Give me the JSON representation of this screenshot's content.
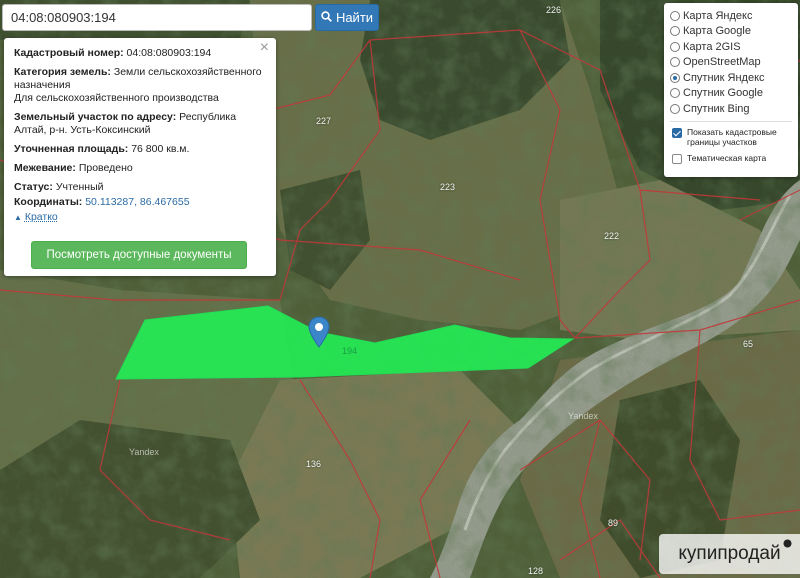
{
  "search": {
    "value": "04:08:080903:194",
    "button_label": "Найти"
  },
  "info": {
    "cadastral_label": "Кадастровый номер:",
    "cadastral_value": "04:08:080903:194",
    "category_label": "Категория земель:",
    "category_value": "Земли сельскохозяйственного назначения",
    "category_extra": "Для сельскохозяйственного производства",
    "address_label": "Земельный участок по адресу:",
    "address_value": "Республика Алтай, р-н. Усть-Коксинский",
    "area_label": "Уточненная площадь:",
    "area_value": "76 800 кв.м.",
    "survey_label": "Межевание:",
    "survey_value": "Проведено",
    "status_label": "Статус:",
    "status_value": "Учтенный",
    "coords_label": "Координаты:",
    "coords_value": "50.113287, 86.467655",
    "collapse_label": "Кратко",
    "docs_button": "Посмотреть доступные документы"
  },
  "layers": {
    "options": [
      {
        "label": "Карта Яндекс",
        "selected": false
      },
      {
        "label": "Карта Google",
        "selected": false
      },
      {
        "label": "Карта 2GIS",
        "selected": false
      },
      {
        "label": "OpenStreetMap",
        "selected": false
      },
      {
        "label": "Спутник Яндекс",
        "selected": true
      },
      {
        "label": "Спутник Google",
        "selected": false
      },
      {
        "label": "Спутник Bing",
        "selected": false
      }
    ],
    "show_cadastral": {
      "label": "Показать кадастровые границы участков",
      "checked": true
    },
    "thematic": {
      "label": "Тематическая карта",
      "checked": false
    }
  },
  "map": {
    "parcel_numbers": [
      "226",
      "227",
      "223",
      "222",
      "65",
      "136",
      "89",
      "128",
      "194"
    ],
    "provider_labels": [
      "Yandex",
      "Yandex"
    ],
    "highlight_color": "#22ee55",
    "boundary_color": "#c0393b",
    "marker_color": "#3a86c8"
  },
  "watermark": {
    "text": "купипродай"
  }
}
